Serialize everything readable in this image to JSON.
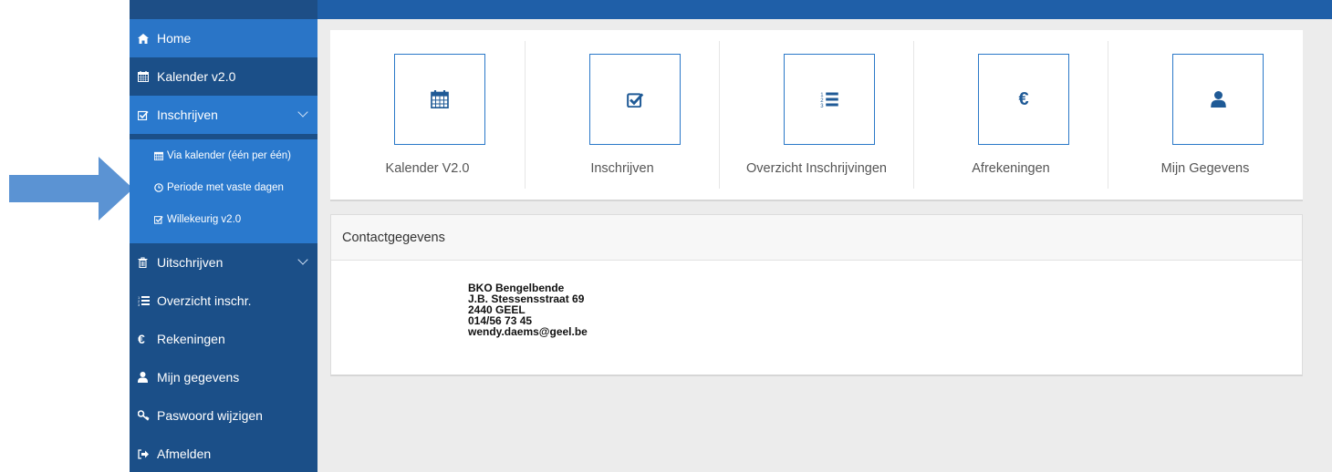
{
  "colors": {
    "sidebar": "#1b4f88",
    "active": "#2a79cd",
    "accent": "#2a78c8",
    "annotation_arrow": "#5b93d3"
  },
  "sidebar": {
    "items": [
      {
        "label": "Home",
        "icon": "home-icon"
      },
      {
        "label": "Kalender v2.0",
        "icon": "calendar-icon"
      },
      {
        "label": "Inschrijven",
        "icon": "checkbox-icon",
        "expanded": true
      },
      {
        "label": "Uitschrijven",
        "icon": "trash-icon"
      },
      {
        "label": "Overzicht inschr.",
        "icon": "list-ol-icon"
      },
      {
        "label": "Rekeningen",
        "icon": "euro-icon"
      },
      {
        "label": "Mijn gegevens",
        "icon": "user-icon"
      },
      {
        "label": "Paswoord wijzigen",
        "icon": "key-icon"
      },
      {
        "label": "Afmelden",
        "icon": "sign-out-icon"
      }
    ],
    "submenu": [
      {
        "label": "Via kalender (één per één)",
        "icon": "calendar-icon"
      },
      {
        "label": "Periode met vaste dagen",
        "icon": "clock-icon"
      },
      {
        "label": "Willekeurig v2.0",
        "icon": "checkbox-icon"
      }
    ]
  },
  "tiles": [
    {
      "label": "Kalender V2.0",
      "icon": "calendar-icon"
    },
    {
      "label": "Inschrijven",
      "icon": "checkbox-icon"
    },
    {
      "label": "Overzicht Inschrijvingen",
      "icon": "list-ol-icon"
    },
    {
      "label": "Afrekeningen",
      "icon": "euro-icon"
    },
    {
      "label": "Mijn Gegevens",
      "icon": "user-icon"
    }
  ],
  "contact": {
    "title": "Contactgegevens",
    "lines": [
      "BKO Bengelbende",
      "J.B. Stessensstraat 69",
      "2440 GEEL",
      "014/56 73 45",
      "wendy.daems@geel.be"
    ]
  }
}
